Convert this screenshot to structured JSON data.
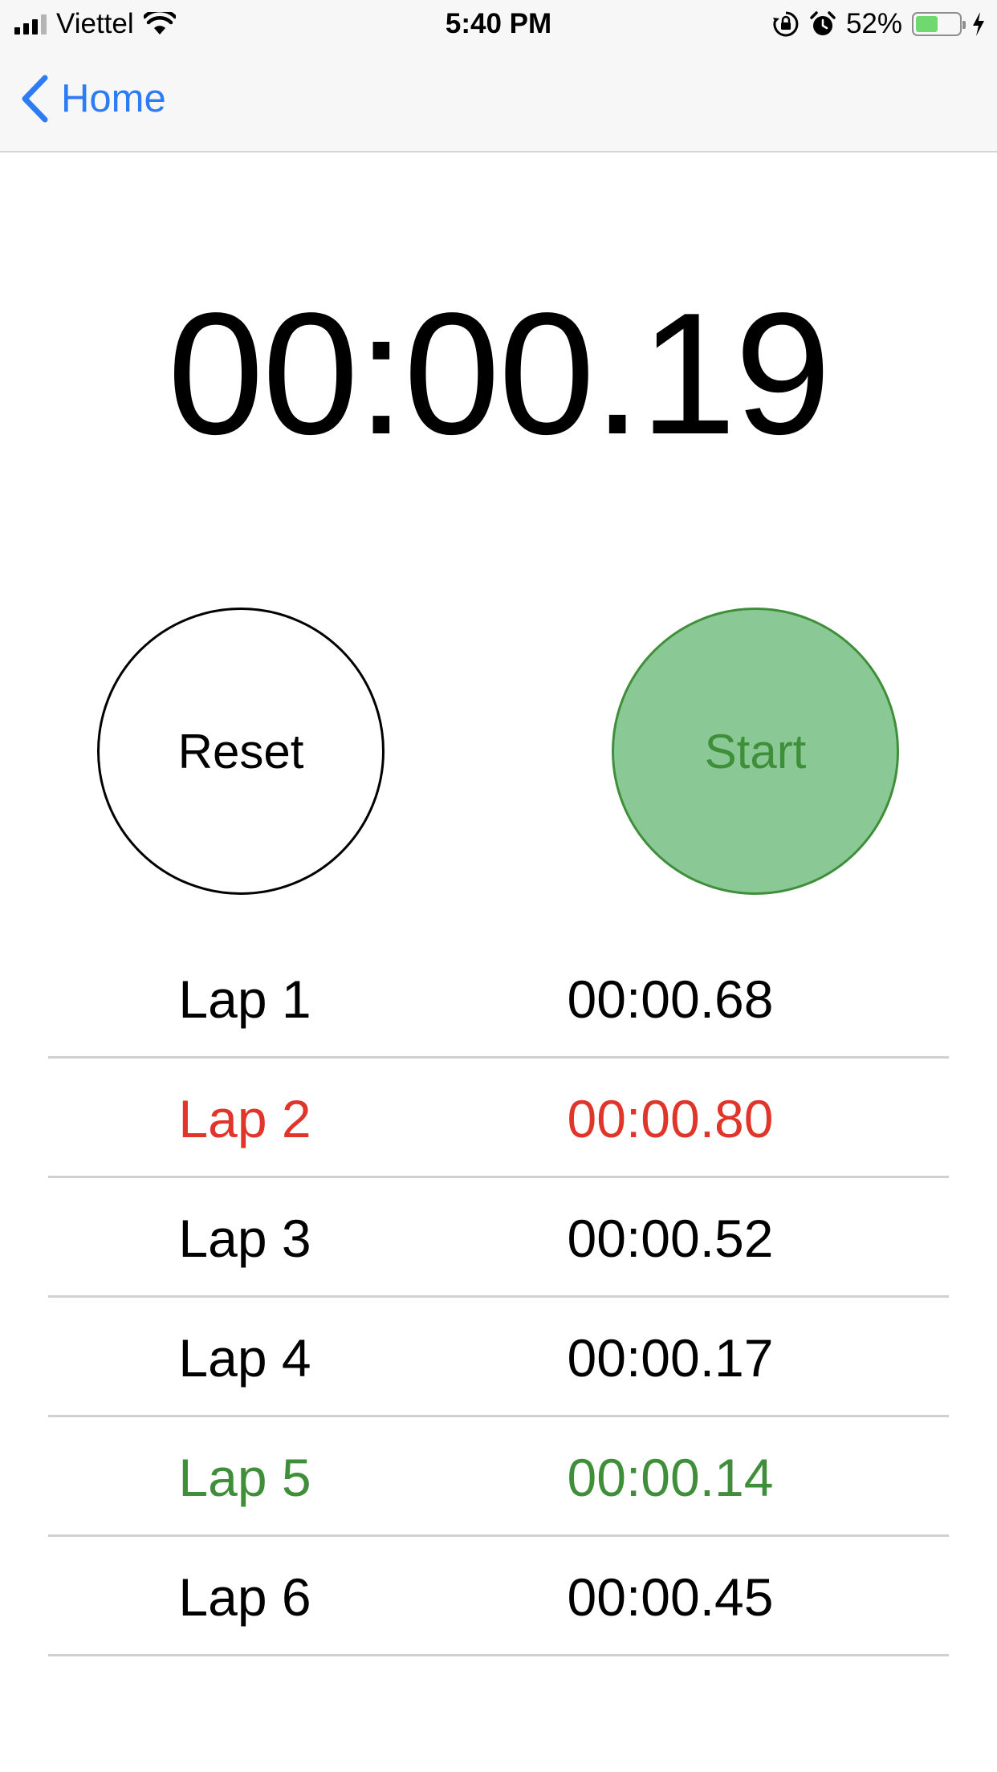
{
  "status_bar": {
    "carrier": "Viettel",
    "time": "5:40 PM",
    "battery_percent": "52%",
    "battery_level": 0.52,
    "icons": [
      "signal-icon",
      "wifi-icon",
      "orientation-lock-icon",
      "alarm-icon",
      "battery-icon",
      "charging-icon"
    ]
  },
  "nav": {
    "back_label": "Home",
    "accent_color": "#2d7cf6"
  },
  "timer": {
    "value": "00:00.19"
  },
  "buttons": {
    "reset_label": "Reset",
    "start_label": "Start"
  },
  "colors": {
    "start_fill": "#8ac995",
    "start_text": "#3f8f3a",
    "slowest_lap": "#e0352b",
    "fastest_lap": "#3f8f3a"
  },
  "laps": [
    {
      "label": "Lap 1",
      "time": "00:00.68",
      "status": "normal"
    },
    {
      "label": "Lap 2",
      "time": "00:00.80",
      "status": "slowest"
    },
    {
      "label": "Lap 3",
      "time": "00:00.52",
      "status": "normal"
    },
    {
      "label": "Lap 4",
      "time": "00:00.17",
      "status": "normal"
    },
    {
      "label": "Lap 5",
      "time": "00:00.14",
      "status": "fastest"
    },
    {
      "label": "Lap 6",
      "time": "00:00.45",
      "status": "normal"
    }
  ]
}
